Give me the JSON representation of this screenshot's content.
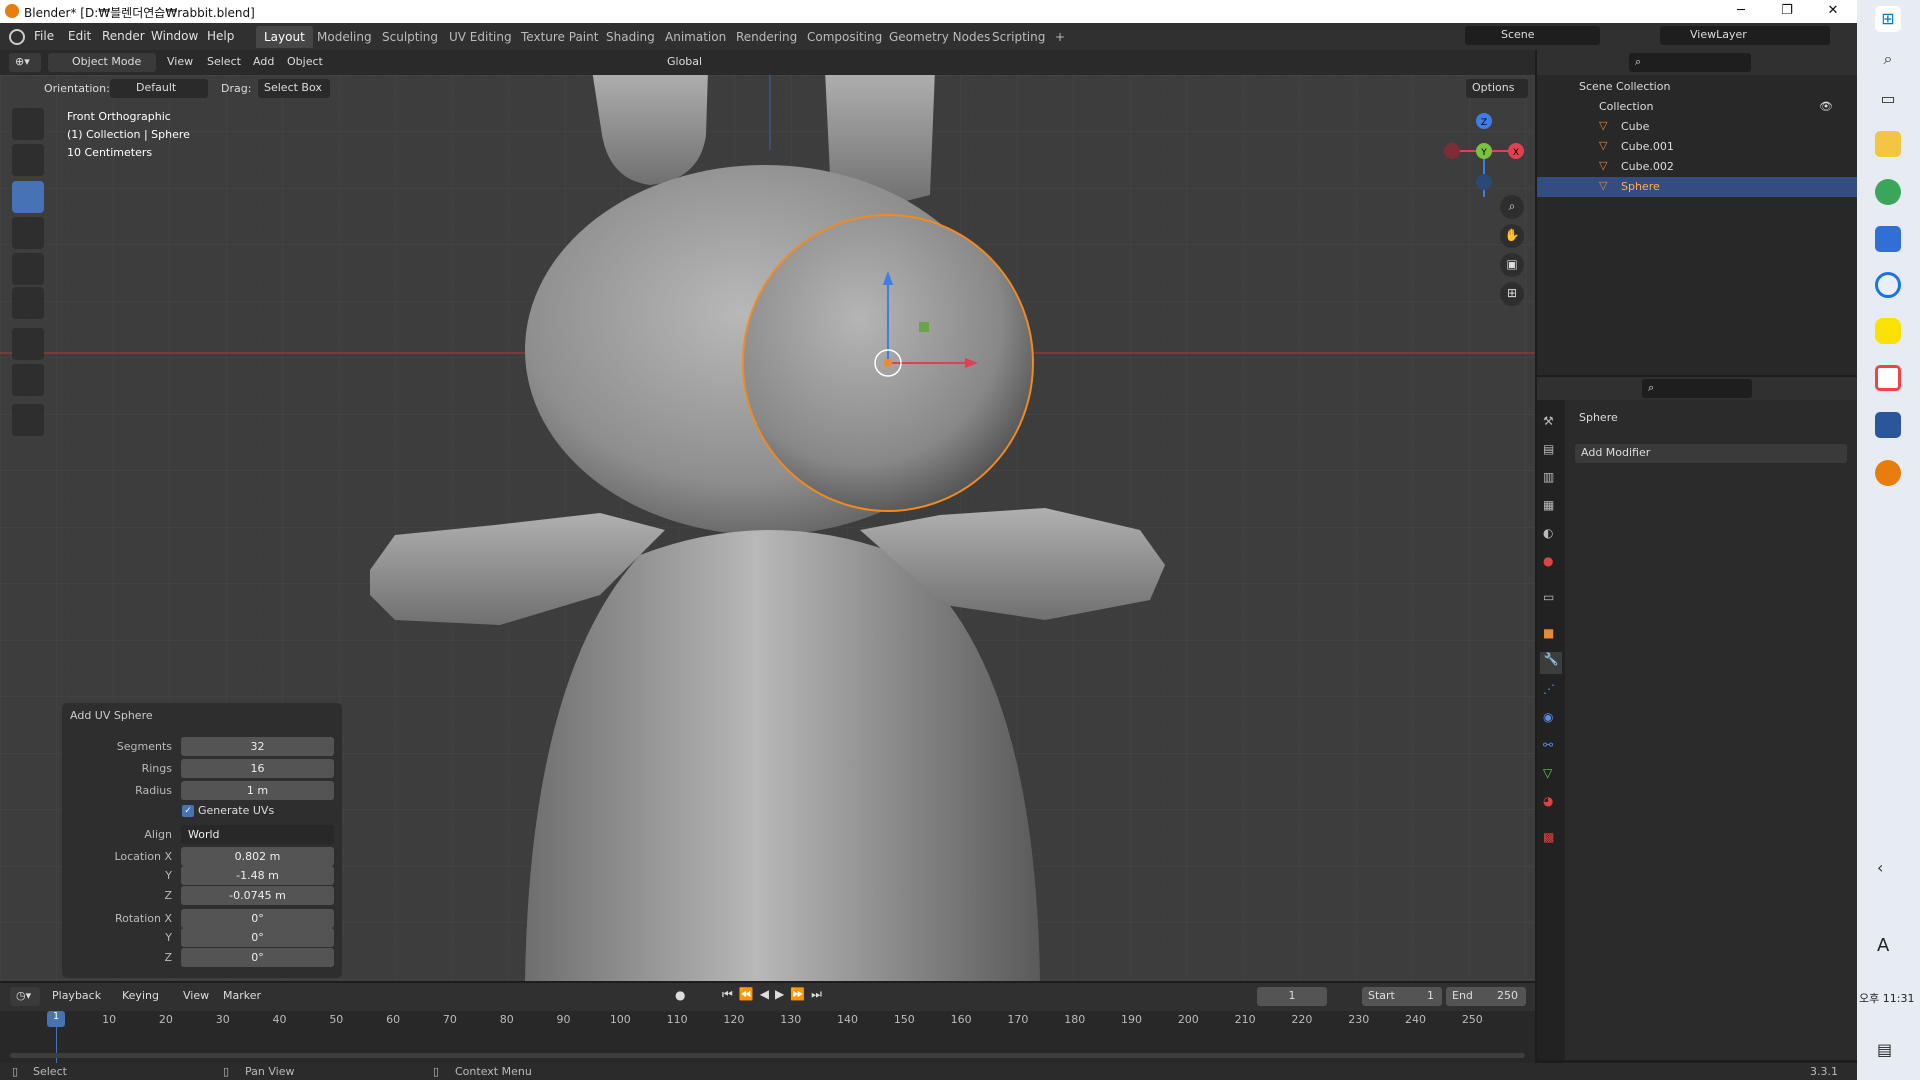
{
  "window": {
    "title": "Blender* [D:₩블렌더연습₩rabbit.blend]",
    "minimize": "─",
    "maximize": "❐",
    "close": "✕"
  },
  "menu": {
    "items": [
      "File",
      "Edit",
      "Render",
      "Window",
      "Help"
    ]
  },
  "workspaces": [
    "Layout",
    "Modeling",
    "Sculpting",
    "UV Editing",
    "Texture Paint",
    "Shading",
    "Animation",
    "Rendering",
    "Compositing",
    "Geometry Nodes",
    "Scripting",
    "+"
  ],
  "scene": {
    "name": "Scene",
    "view_layer": "ViewLayer"
  },
  "viewport_header": {
    "mode": "Object Mode",
    "view": "View",
    "select": "Select",
    "add": "Add",
    "object": "Object",
    "transform": "Global"
  },
  "tool_settings": {
    "orientation_label": "Orientation:",
    "orientation": "Default",
    "drag_label": "Drag:",
    "drag": "Select Box",
    "options": "Options"
  },
  "overlay": {
    "view": "Front Orthographic",
    "collection": "(1) Collection | Sphere",
    "scale": "10 Centimeters"
  },
  "gizmo": {
    "z": "Z",
    "y": "Y",
    "x": "X"
  },
  "redo_panel": {
    "title": "Add UV Sphere",
    "segments_label": "Segments",
    "segments": "32",
    "rings_label": "Rings",
    "rings": "16",
    "radius_label": "Radius",
    "radius": "1 m",
    "generate_uvs": "Generate UVs",
    "align_label": "Align",
    "align": "World",
    "loc_x_label": "Location X",
    "loc_x": "0.802 m",
    "loc_y_label": "Y",
    "loc_y": "-1.48 m",
    "loc_z_label": "Z",
    "loc_z": "-0.0745 m",
    "rot_x_label": "Rotation X",
    "rot_x": "0°",
    "rot_y_label": "Y",
    "rot_y": "0°",
    "rot_z_label": "Z",
    "rot_z": "0°"
  },
  "outliner": {
    "scene_collection": "Scene Collection",
    "collection": "Collection",
    "objects": [
      "Cube",
      "Cube.001",
      "Cube.002",
      "Sphere"
    ]
  },
  "properties": {
    "object_name": "Sphere",
    "add_modifier": "Add Modifier"
  },
  "timeline": {
    "playback": "Playback",
    "keying": "Keying",
    "view": "View",
    "marker": "Marker",
    "current_frame": "1",
    "start_label": "Start",
    "start": "1",
    "end_label": "End",
    "end": "250",
    "ticks": [
      "1",
      "10",
      "20",
      "30",
      "40",
      "50",
      "60",
      "70",
      "80",
      "90",
      "100",
      "110",
      "120",
      "130",
      "140",
      "150",
      "160",
      "170",
      "180",
      "190",
      "200",
      "210",
      "220",
      "230",
      "240",
      "250"
    ]
  },
  "statusbar": {
    "select": "Select",
    "pan_view": "Pan View",
    "context_menu": "Context Menu",
    "version": "3.3.1"
  },
  "system": {
    "time": "오후 11:31",
    "ime": "A"
  }
}
